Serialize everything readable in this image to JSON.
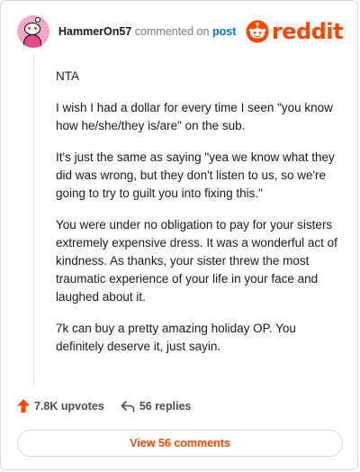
{
  "header": {
    "username": "HammerOn57",
    "action_text": "commented on",
    "post_link": "post",
    "logo_text": "reddit"
  },
  "comment": {
    "paragraphs": [
      "NTA",
      "I wish I had a dollar for every time I seen \"you know how he/she/they is/are\" on the sub.",
      "It's just the same as saying \"yea we know what they did was wrong, but they don't listen to us, so we're going to try to guilt you into fixing this.\"",
      "You were under no obligation to pay for your sisters extremely expensive dress. It was a wonderful act of kindness. As thanks, your sister threw the most traumatic experience of your life in your face and laughed about it.",
      "7k can buy a pretty amazing holiday OP. You definitely deserve it, just sayin."
    ]
  },
  "actions": {
    "upvotes": "7.8K upvotes",
    "replies": "56 replies"
  },
  "view_button": "View 56 comments",
  "icons": {
    "avatar": "snoo-avatar-icon",
    "logo": "reddit-snoo-icon",
    "upvote": "upvote-arrow-icon",
    "reply": "reply-arrow-icon"
  },
  "colors": {
    "brand": "#ff4500",
    "link": "#0079d3",
    "avatar_bg": "#f4a8c8"
  }
}
